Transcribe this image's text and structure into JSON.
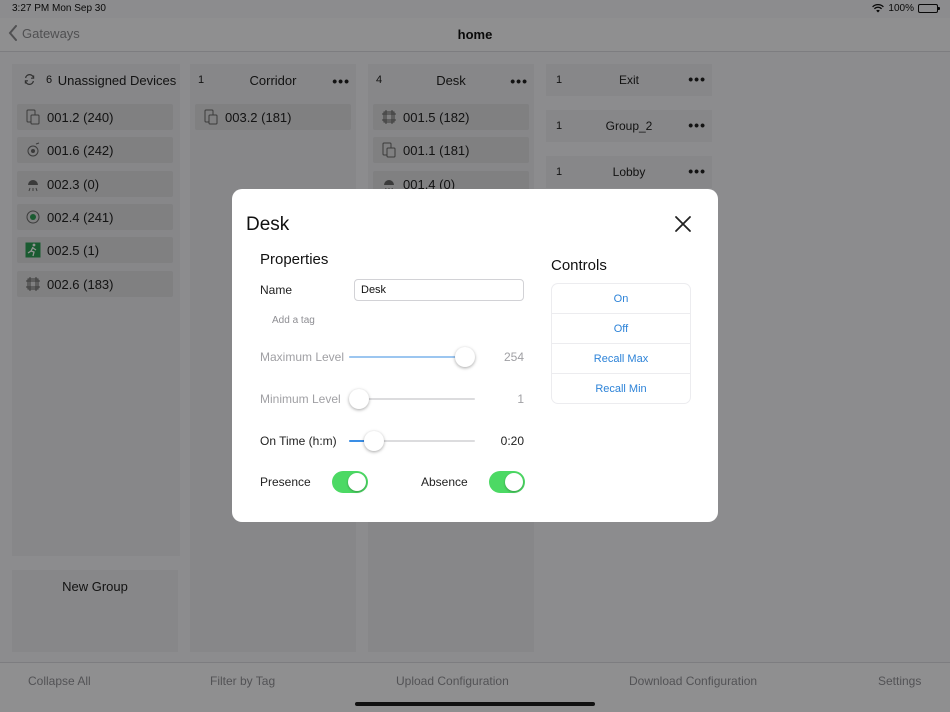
{
  "status": {
    "time": "3:27 PM",
    "date": "Mon Sep 30",
    "battery": "100%"
  },
  "nav": {
    "back_label": "Gateways",
    "title": "home"
  },
  "columns": [
    {
      "count": "6",
      "title": "Unassigned Devices",
      "devices": [
        {
          "label": "001.2 (240)",
          "icon": "switch-icon"
        },
        {
          "label": "001.6 (242)",
          "icon": "sensor-icon"
        },
        {
          "label": "002.3 (0)",
          "icon": "lamp-icon"
        },
        {
          "label": "002.4 (241)",
          "icon": "sensor-green-icon"
        },
        {
          "label": "002.5 (1)",
          "icon": "exit-sign-icon"
        },
        {
          "label": "002.6 (183)",
          "icon": "light-fixture-icon"
        }
      ]
    },
    {
      "count": "1",
      "title": "Corridor",
      "devices": [
        {
          "label": "003.2 (181)",
          "icon": "switch-icon"
        }
      ]
    },
    {
      "count": "4",
      "title": "Desk",
      "devices": [
        {
          "label": "001.5 (182)",
          "icon": "light-fixture-icon"
        },
        {
          "label": "001.1 (181)",
          "icon": "switch-icon"
        },
        {
          "label": "001.4 (0)",
          "icon": "lamp-icon"
        }
      ]
    }
  ],
  "groups": [
    {
      "count": "1",
      "title": "Exit"
    },
    {
      "count": "1",
      "title": "Group_2"
    },
    {
      "count": "1",
      "title": "Lobby"
    }
  ],
  "new_group_label": "New Group",
  "toolbar": {
    "collapse_all": "Collapse All",
    "filter_by_tag": "Filter by Tag",
    "upload_configuration": "Upload Configuration",
    "download_configuration": "Download Configuration",
    "settings": "Settings"
  },
  "modal": {
    "title": "Desk",
    "properties_heading": "Properties",
    "name_label": "Name",
    "name_value": "Desk",
    "add_tag": "Add a tag",
    "maximum_level_label": "Maximum Level",
    "maximum_level_value": "254",
    "maximum_level_fraction": 1.0,
    "minimum_level_label": "Minimum Level",
    "minimum_level_value": "1",
    "minimum_level_fraction": 0.0,
    "on_time_label": "On Time (h:m)",
    "on_time_value": "0:20",
    "on_time_fraction": 0.14,
    "presence_label": "Presence",
    "presence_on": true,
    "absence_label": "Absence",
    "absence_on": true,
    "controls_heading": "Controls",
    "controls": [
      "On",
      "Off",
      "Recall Max",
      "Recall Min"
    ]
  },
  "colors": {
    "accent": "#2d83d8",
    "toggle_on": "#4cd964",
    "slider_fill": "#3a8ee6"
  }
}
